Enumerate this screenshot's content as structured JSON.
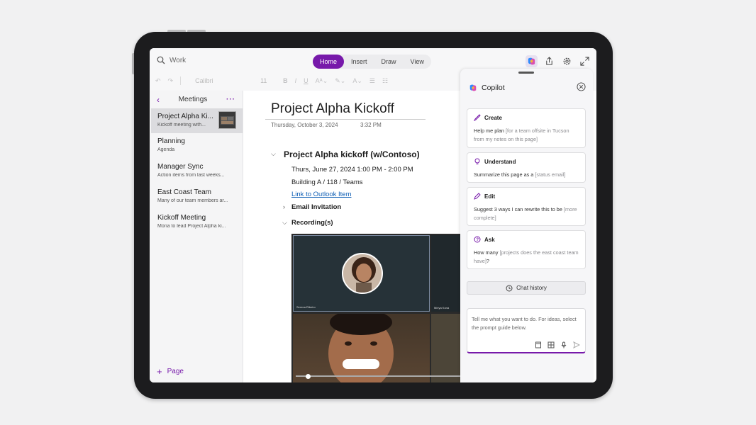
{
  "search": {
    "placeholder": "Work"
  },
  "tabs": [
    "Home",
    "Insert",
    "Draw",
    "View"
  ],
  "toolbar": {
    "font": "Calibri",
    "size": "11"
  },
  "sidebar": {
    "title": "Meetings",
    "items": [
      {
        "title": "Project Alpha Ki...",
        "sub": "Kickoff meeting with..."
      },
      {
        "title": "Planning",
        "sub": "Agenda"
      },
      {
        "title": "Manager Sync",
        "sub": "Action items from last weeks..."
      },
      {
        "title": "East Coast Team",
        "sub": "Many of our team members ar..."
      },
      {
        "title": "Kickoff Meeting",
        "sub": "Mona to lead Project Alpha ki..."
      }
    ],
    "add_label": "Page"
  },
  "page": {
    "title": "Project Alpha Kickoff",
    "date": "Thursday, October 3, 2024",
    "time": "3:32 PM",
    "section_title": "Project Alpha kickoff (w/Contoso)",
    "when": "Thurs, June 27, 2024 1:00 PM - 2:00 PM",
    "where": "Building A / 118 / Teams",
    "link": "Link to Outlook Item",
    "email_invitation": "Email Invitation",
    "recordings": "Recording(s)",
    "video": {
      "tile1_name": "Serena Ribeiro",
      "tile2_name": "Miriya Kona"
    }
  },
  "copilot": {
    "title": "Copilot",
    "cards": [
      {
        "label": "Create",
        "icon": "pen-sparkle-icon",
        "text": "Help me plan ",
        "placeholder": "[for a team offsite in Tucson from my notes on this page]"
      },
      {
        "label": "Understand",
        "icon": "lightbulb-icon",
        "text": "Summarize this page as a ",
        "placeholder": "[status email]"
      },
      {
        "label": "Edit",
        "icon": "pencil-icon",
        "text": "Suggest 3 ways I can rewrite this to be ",
        "placeholder": "[more complete]"
      },
      {
        "label": "Ask",
        "icon": "chat-question-icon",
        "text": "How many ",
        "placeholder": "[projects does the east coast team have]",
        "suffix": "?"
      }
    ],
    "chat_history": "Chat history",
    "input_placeholder": "Tell me what you want to do. For ideas, select the prompt guide below."
  },
  "colors": {
    "accent": "#7719aa",
    "link": "#0f5fb5"
  }
}
